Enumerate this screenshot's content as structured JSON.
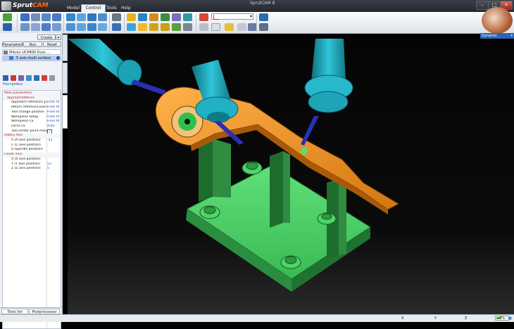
{
  "app": {
    "brand_prefix": "Sprut",
    "brand_suffix": "CAM",
    "window_title": "SprutCAM 8",
    "main_tabs": [
      {
        "label": "Model"
      },
      {
        "label": "Control"
      },
      {
        "label": "Tools"
      },
      {
        "label": "Help"
      }
    ],
    "active_main_tab": "Control",
    "window_buttons": {
      "minimize": "–",
      "maximize": "□",
      "close": "✕"
    }
  },
  "toolbar": {
    "cs_select_value": "",
    "render_mode": "Dynamic"
  },
  "panel": {
    "buttons": {
      "create": "Create",
      "parameters": "Parameters",
      "run": "Run",
      "reset": "Reset"
    },
    "machine": "Mikron UCP800 Duro ...",
    "operation": "5 axis multi surface",
    "settings_label": "Настройка",
    "properties": [
      {
        "key": "Main parameters",
        "value": "",
        "kind": "group"
      },
      {
        "key": "Approach/Return",
        "value": "",
        "kind": "sub"
      },
      {
        "key": "Approach reference p",
        "value": "From th",
        "kind": "item"
      },
      {
        "key": "Return reference poin",
        "value": "From th",
        "kind": "item"
      },
      {
        "key": "Tool change position",
        "value": "From th",
        "kind": "item"
      },
      {
        "key": "Workpiece setup",
        "value": "From th",
        "kind": "item"
      },
      {
        "key": "Workpiece CS",
        "value": "From th",
        "kind": "item"
      },
      {
        "key": "Local CS",
        "value": "Auto",
        "kind": "item"
      },
      {
        "key": "Tool center point mana",
        "value": "",
        "kind": "check"
      },
      {
        "key": "Rotary Axis",
        "value": "",
        "kind": "group"
      },
      {
        "key": "A (A axis position)",
        "value": "-41",
        "kind": "item"
      },
      {
        "key": "C (C axis position)",
        "value": "",
        "kind": "item"
      },
      {
        "key": "S (Spindle position)",
        "value": "",
        "kind": "item"
      },
      {
        "key": "Linear Axis",
        "value": "",
        "kind": "group"
      },
      {
        "key": "X (X axis position)",
        "value": "",
        "kind": "item"
      },
      {
        "key": "Y (Y axis position)",
        "value": "53",
        "kind": "item"
      },
      {
        "key": "Z (Z axis position)",
        "value": "5",
        "kind": "item"
      }
    ],
    "bottom_tabs": {
      "tools_list": "Tools list",
      "postprocessor": "Postprocessor"
    }
  },
  "statusbar": {
    "x_label": "X",
    "y_label": "Y",
    "z_label": "Z",
    "zoom": "2%"
  },
  "colors": {
    "tool_holder": "#23b7c9",
    "part": "#f08a19",
    "fixture": "#4fd468",
    "fixture_dark": "#1f6d2d",
    "accent_blue": "#2b65b8"
  }
}
